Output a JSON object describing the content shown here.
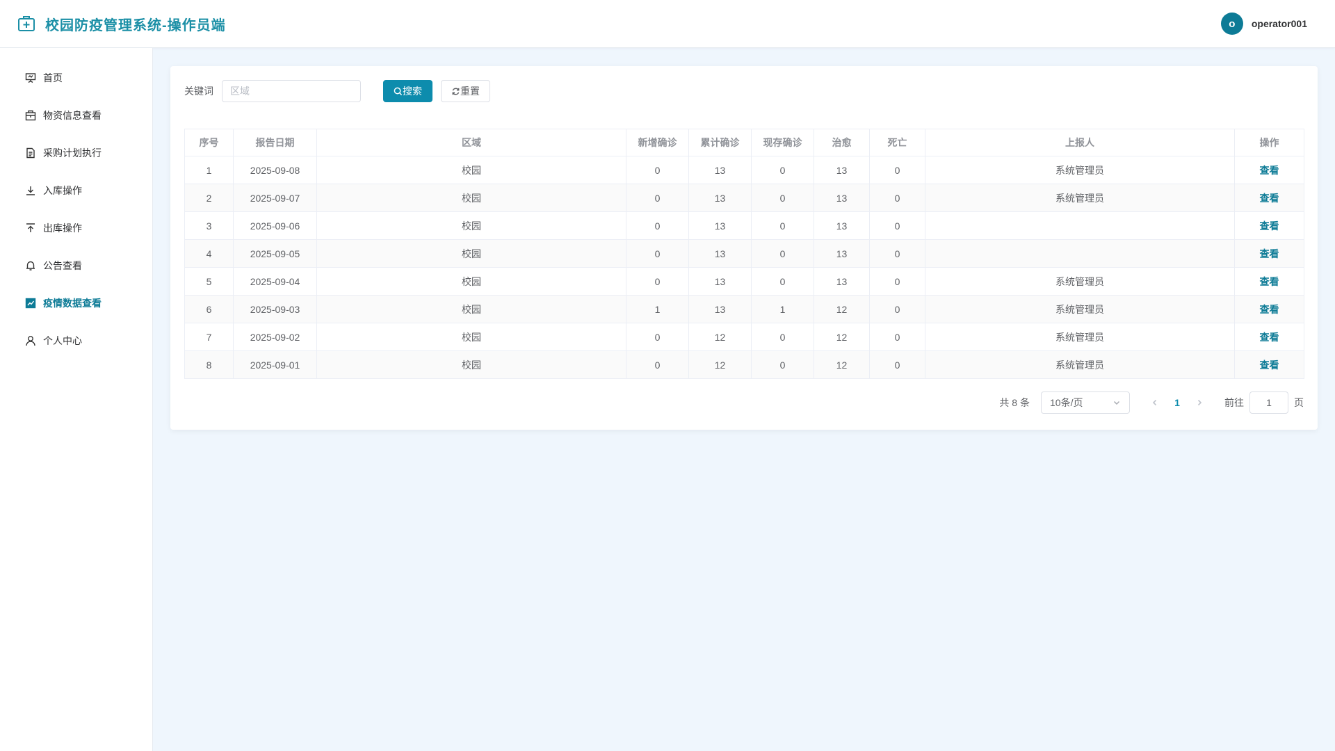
{
  "app": {
    "title": "校园防疫管理系统-操作员端"
  },
  "user": {
    "avatar_letter": "o",
    "name": "operator001"
  },
  "sidebar": {
    "items": [
      {
        "label": "首页",
        "icon": "presentation-board-icon",
        "active": false
      },
      {
        "label": "物资信息查看",
        "icon": "package-icon",
        "active": false
      },
      {
        "label": "采购计划执行",
        "icon": "document-icon",
        "active": false
      },
      {
        "label": "入库操作",
        "icon": "download-icon",
        "active": false
      },
      {
        "label": "出库操作",
        "icon": "upload-icon",
        "active": false
      },
      {
        "label": "公告查看",
        "icon": "bell-icon",
        "active": false
      },
      {
        "label": "疫情数据查看",
        "icon": "trend-chart-icon",
        "active": true
      },
      {
        "label": "个人中心",
        "icon": "user-icon",
        "active": false
      }
    ]
  },
  "search": {
    "keyword_label": "关键词",
    "placeholder": "区域",
    "value": "",
    "search_label": "搜索",
    "reset_label": "重置"
  },
  "table": {
    "columns": [
      "序号",
      "报告日期",
      "区域",
      "新增确诊",
      "累计确诊",
      "现存确诊",
      "治愈",
      "死亡",
      "上报人",
      "操作"
    ],
    "rows": [
      [
        "1",
        "2025-09-08",
        "校园",
        "0",
        "13",
        "0",
        "13",
        "0",
        "系统管理员",
        "查看"
      ],
      [
        "2",
        "2025-09-07",
        "校园",
        "0",
        "13",
        "0",
        "13",
        "0",
        "系统管理员",
        "查看"
      ],
      [
        "3",
        "2025-09-06",
        "校园",
        "0",
        "13",
        "0",
        "13",
        "0",
        "",
        "查看"
      ],
      [
        "4",
        "2025-09-05",
        "校园",
        "0",
        "13",
        "0",
        "13",
        "0",
        "",
        "查看"
      ],
      [
        "5",
        "2025-09-04",
        "校园",
        "0",
        "13",
        "0",
        "13",
        "0",
        "系统管理员",
        "查看"
      ],
      [
        "6",
        "2025-09-03",
        "校园",
        "1",
        "13",
        "1",
        "12",
        "0",
        "系统管理员",
        "查看"
      ],
      [
        "7",
        "2025-09-02",
        "校园",
        "0",
        "12",
        "0",
        "12",
        "0",
        "系统管理员",
        "查看"
      ],
      [
        "8",
        "2025-09-01",
        "校园",
        "0",
        "12",
        "0",
        "12",
        "0",
        "系统管理员",
        "查看"
      ]
    ]
  },
  "pagination": {
    "total_text": "共 8 条",
    "page_size": "10条/页",
    "current_page": "1",
    "goto_label": "前往",
    "goto_value": "1",
    "goto_suffix": "页"
  },
  "colors": {
    "accent": "#0d8cad",
    "title": "#1b8fa6",
    "page_bg": "#eff6fd"
  }
}
